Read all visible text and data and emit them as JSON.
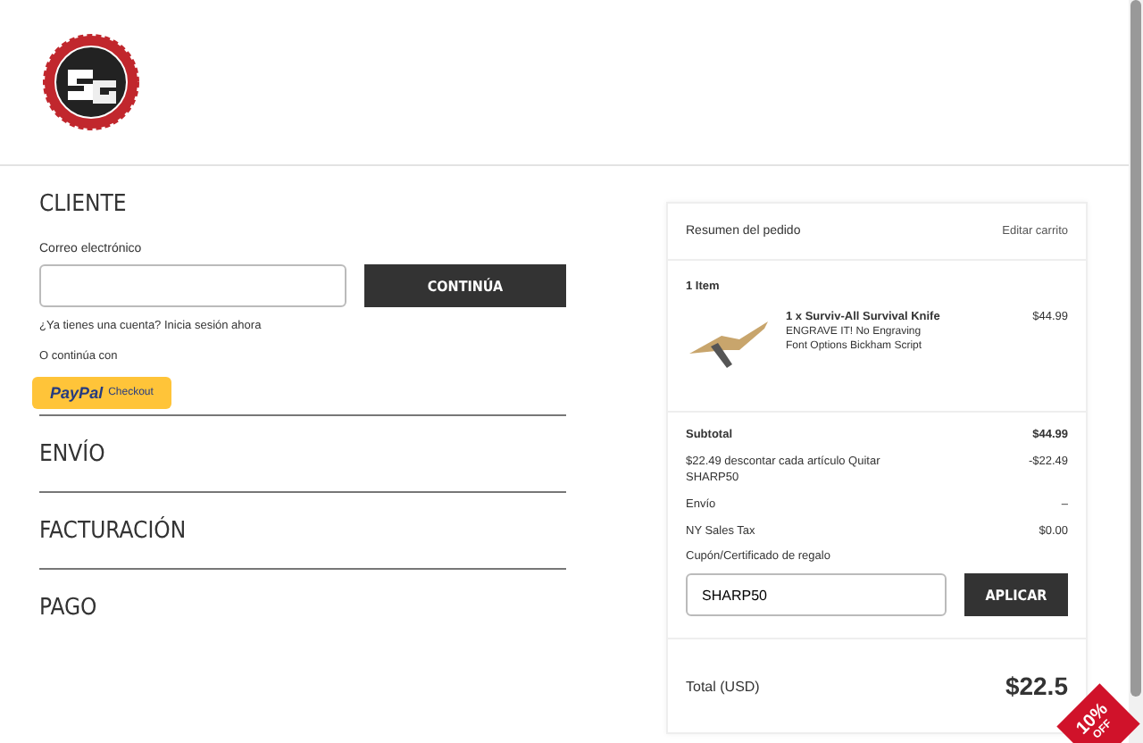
{
  "customer": {
    "title": "CLIENTE",
    "email_label": "Correo electrónico",
    "continue_button": "CONTINÚA",
    "login_prompt": "¿Ya tienes una cuenta? Inicia sesión ahora",
    "alt_label": "O continúa con",
    "paypal": {
      "brand": "PayPal",
      "label": "Checkout"
    }
  },
  "sections": [
    "ENVÍO",
    "FACTURACIÓN",
    "PAGO"
  ],
  "summary": {
    "title": "Resumen del pedido",
    "edit_link": "Editar carrito",
    "count": "1 Item",
    "item": {
      "name": "1 x Surviv-All Survival Knife",
      "options": [
        "ENGRAVE IT! No Engraving",
        "Font Options Bickham Script"
      ],
      "price": "$44.99"
    },
    "lines": [
      {
        "label": "Subtotal",
        "value": "$44.99",
        "kind": "subtotal"
      },
      {
        "label": "$22.49 descontar cada artículo Quitar SHARP50",
        "value": "-$22.49",
        "kind": "line"
      },
      {
        "label": "Envío",
        "value": "–",
        "kind": "line"
      },
      {
        "label": "NY Sales Tax",
        "value": "$0.00",
        "kind": "line"
      }
    ],
    "coupon_label": "Cupón/Certificado de regalo",
    "coupon_value": "SHARP50",
    "apply_button": "APLICAR",
    "total_label": "Total (USD)",
    "total_value": "$22.5"
  },
  "promo": {
    "amount": "10%",
    "label": "OFF"
  }
}
